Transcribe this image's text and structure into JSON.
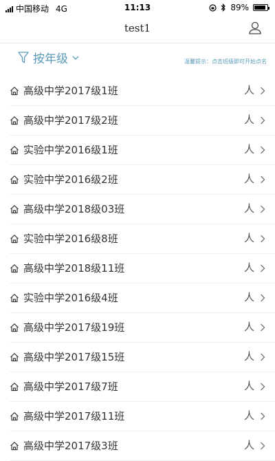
{
  "status": {
    "carrier": "中国移动",
    "network": "4G",
    "time": "11:13",
    "battery": "89%",
    "battery_level": 0.89
  },
  "nav": {
    "title": "test1",
    "user_icon": "user-icon"
  },
  "filter": {
    "label": "按年级",
    "icon": "funnel-icon",
    "tip": "温馨提示：点击班级即可开始点名"
  },
  "classes": [
    {
      "name": "高级中学2017级1班",
      "action": "人"
    },
    {
      "name": "高级中学2017级2班",
      "action": "人"
    },
    {
      "name": "实验中学2016级1班",
      "action": "人"
    },
    {
      "name": "实验中学2016级2班",
      "action": "人"
    },
    {
      "name": "高级中学2018级03班",
      "action": "人"
    },
    {
      "name": "实验中学2016级8班",
      "action": "人"
    },
    {
      "name": "高级中学2018级11班",
      "action": "人"
    },
    {
      "name": "实验中学2016级4班",
      "action": "人"
    },
    {
      "name": "高级中学2017级19班",
      "action": "人"
    },
    {
      "name": "高级中学2017级15班",
      "action": "人"
    },
    {
      "name": "高级中学2017级7班",
      "action": "人"
    },
    {
      "name": "高级中学2017级11班",
      "action": "人"
    },
    {
      "name": "高级中学2017级3班",
      "action": "人"
    }
  ],
  "colors": {
    "accent": "#5a9ab8",
    "divider": "#eeeeee"
  }
}
